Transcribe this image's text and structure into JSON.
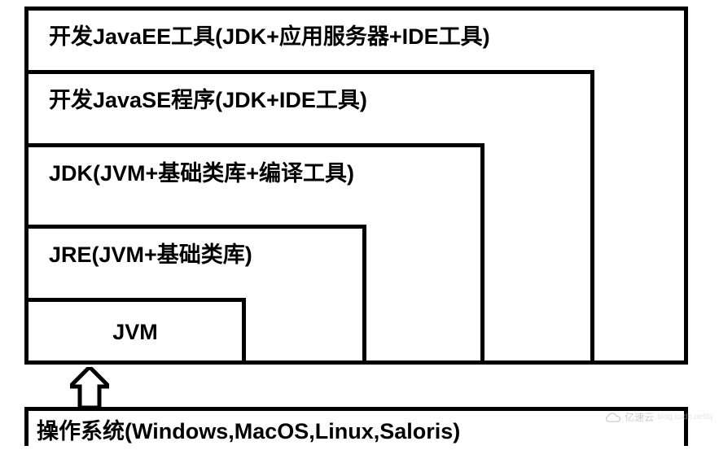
{
  "layers": {
    "javaee": "开发JavaEE工具(JDK+应用服务器+IDE工具)",
    "javase": "开发JavaSE程序(JDK+IDE工具)",
    "jdk": "JDK(JVM+基础类库+编译工具)",
    "jre": "JRE(JVM+基础类库)",
    "jvm": "JVM",
    "os": "操作系统(Windows,MacOS,Linux,Saloris)"
  },
  "watermark": {
    "brand": "亿速云",
    "source": "blog.csdn.net/q"
  }
}
